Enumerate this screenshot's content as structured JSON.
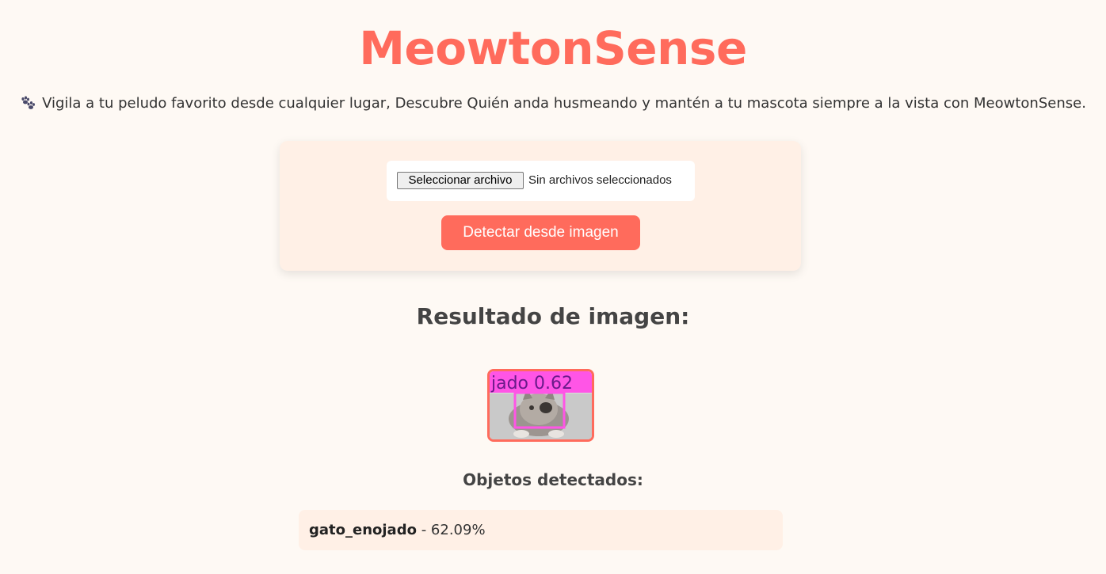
{
  "header": {
    "title": "MeowtonSense",
    "tagline": "Vigila a tu peludo favorito desde cualquier lugar, Descubre Quién anda husmeando y mantén a tu mascota siempre a la vista con MeowtonSense.",
    "tagline_icon": "paw-prints-icon"
  },
  "upload": {
    "file_button_label": "Seleccionar archivo",
    "file_status": "Sin archivos seleccionados",
    "detect_button_label": "Detectar desde imagen"
  },
  "result": {
    "heading": "Resultado de imagen:",
    "image_overlay_text": "jado 0.62",
    "detected_heading": "Objetos detectados:",
    "detections": [
      {
        "label": "gato_enojado",
        "separator": " - ",
        "confidence": "62.09%"
      }
    ]
  },
  "colors": {
    "accent": "#ff6b5c",
    "background": "#fef9f4",
    "card": "#fff0e6",
    "bounding_box": "#ff55e6"
  }
}
